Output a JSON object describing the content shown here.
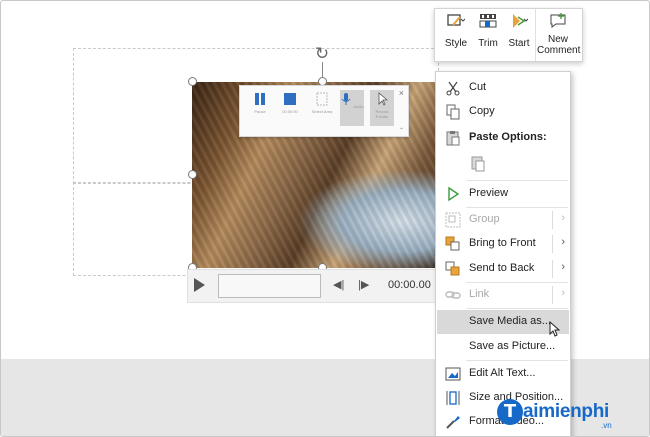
{
  "colors": {
    "accent": "#1769c9",
    "selection": "#d9d9d9",
    "disabled": "#a8a8a8",
    "slide_gray": "#e6e6e6"
  },
  "recording_toolbar": {
    "buttons": [
      {
        "label": "Pause",
        "icon": "pause-icon"
      },
      {
        "label": "00:00:00",
        "icon": "stop-icon"
      },
      {
        "label": "Select Area",
        "icon": "select-area-icon"
      },
      {
        "label": "Audio",
        "icon": "microphone-icon"
      },
      {
        "label": "Record Pointer",
        "icon": "pointer-icon"
      }
    ],
    "close": "×"
  },
  "player": {
    "time": "00:00.00"
  },
  "mini_toolbar": {
    "items": [
      {
        "label": "Style",
        "icon": "style-icon"
      },
      {
        "label": "Trim",
        "icon": "trim-icon"
      },
      {
        "label": "Start",
        "icon": "start-icon"
      },
      {
        "label": "New Comment",
        "icon": "new-comment-icon"
      }
    ]
  },
  "context_menu": {
    "items": [
      {
        "label": "Cut",
        "icon": "scissors-icon"
      },
      {
        "label": "Copy",
        "icon": "copy-icon"
      },
      {
        "label": "Paste Options:",
        "icon": "paste-icon"
      },
      {
        "label": "Preview",
        "icon": "play-icon"
      },
      {
        "label": "Group",
        "icon": "group-icon"
      },
      {
        "label": "Bring to Front",
        "icon": "bring-front-icon"
      },
      {
        "label": "Send to Back",
        "icon": "send-back-icon"
      },
      {
        "label": "Link",
        "icon": "link-icon"
      },
      {
        "label": "Save Media as...",
        "icon": ""
      },
      {
        "label": "Save as Picture...",
        "icon": ""
      },
      {
        "label": "Edit Alt Text...",
        "icon": "alt-text-icon"
      },
      {
        "label": "Size and Position...",
        "icon": "size-position-icon"
      },
      {
        "label": "Format Video...",
        "icon": "format-video-icon"
      }
    ],
    "submenu_arrow": "›"
  },
  "watermark": {
    "initial": "T",
    "name": "aimienphi",
    "suffix": ".vn"
  }
}
